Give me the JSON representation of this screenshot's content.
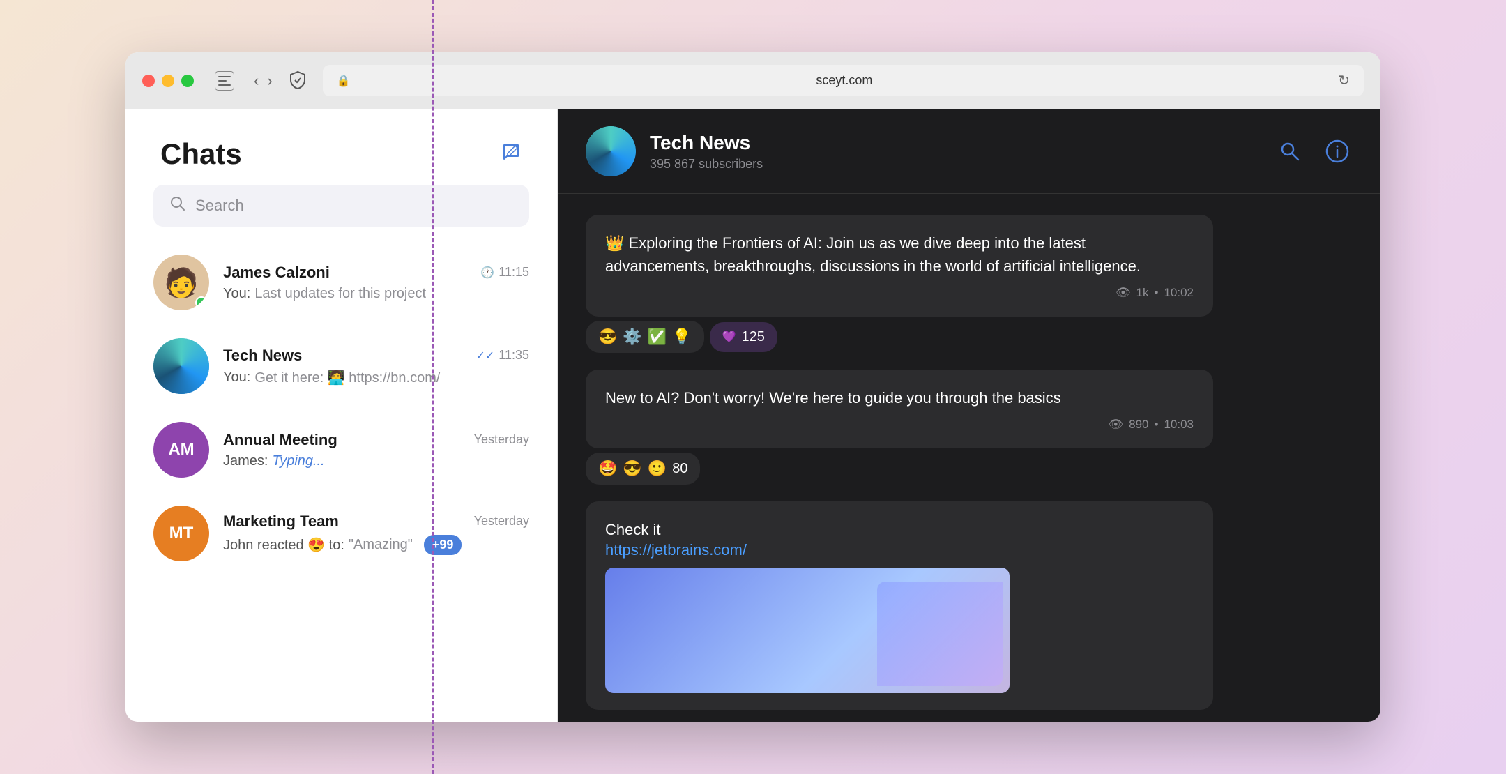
{
  "browser": {
    "url": "sceyt.com",
    "back_label": "‹",
    "forward_label": "›",
    "reload_label": "↻"
  },
  "sidebar": {
    "title": "Chats",
    "compose_label": "✏",
    "search_placeholder": "Search",
    "chats": [
      {
        "id": "james",
        "name": "James Calzoni",
        "preview_label": "You:",
        "preview": "Last updates for this project",
        "time": "11:15",
        "time_icon": "clock",
        "has_online": true,
        "avatar_type": "image",
        "avatar_emoji": "👤"
      },
      {
        "id": "tech-news",
        "name": "Tech News",
        "preview_label": "You:",
        "preview": "Get it here: 🧑‍💻 https://bn.com/",
        "time": "11:35",
        "time_icon": "check",
        "has_online": false,
        "avatar_type": "gradient"
      },
      {
        "id": "annual-meeting",
        "name": "Annual Meeting",
        "preview_label": "James:",
        "preview": "Typing...",
        "preview_is_typing": true,
        "time": "Yesterday",
        "time_icon": "none",
        "has_online": false,
        "avatar_type": "initials",
        "initials": "AM",
        "avatar_color": "#8e44ad"
      },
      {
        "id": "marketing-team",
        "name": "Marketing Team",
        "preview_label": "John reacted 😍 to:",
        "preview": "\"Amazing\"",
        "time": "Yesterday",
        "time_icon": "none",
        "has_online": false,
        "avatar_type": "initials",
        "initials": "MT",
        "avatar_color": "#e67e22",
        "unread_count": "+99"
      }
    ]
  },
  "channel": {
    "name": "Tech News",
    "subscribers": "395 867 subscribers",
    "messages": [
      {
        "id": "msg1",
        "text": "👑 Exploring the Frontiers of AI: Join us as we dive deep into the latest advancements, breakthroughs, discussions in the world of artificial intelligence.",
        "views": "1k",
        "time": "10:02",
        "reactions": [
          {
            "emoji": "😎",
            "count": null
          },
          {
            "emoji": "⚙️",
            "count": null
          },
          {
            "emoji": "✅",
            "count": null
          },
          {
            "emoji": "💡",
            "count": null
          },
          {
            "emoji": "💜",
            "count": "125"
          }
        ]
      },
      {
        "id": "msg2",
        "text": "New to AI? Don't worry! We're here to guide you through the basics",
        "views": "890",
        "time": "10:03",
        "reactions": [
          {
            "emoji": "🤩",
            "count": null
          },
          {
            "emoji": "😎",
            "count": null
          },
          {
            "emoji": "🙂",
            "count": null
          },
          {
            "emoji": null,
            "count": "80"
          }
        ]
      },
      {
        "id": "msg3",
        "text": "Check it",
        "link": "https://jetbrains.com/",
        "has_image": true
      }
    ]
  }
}
